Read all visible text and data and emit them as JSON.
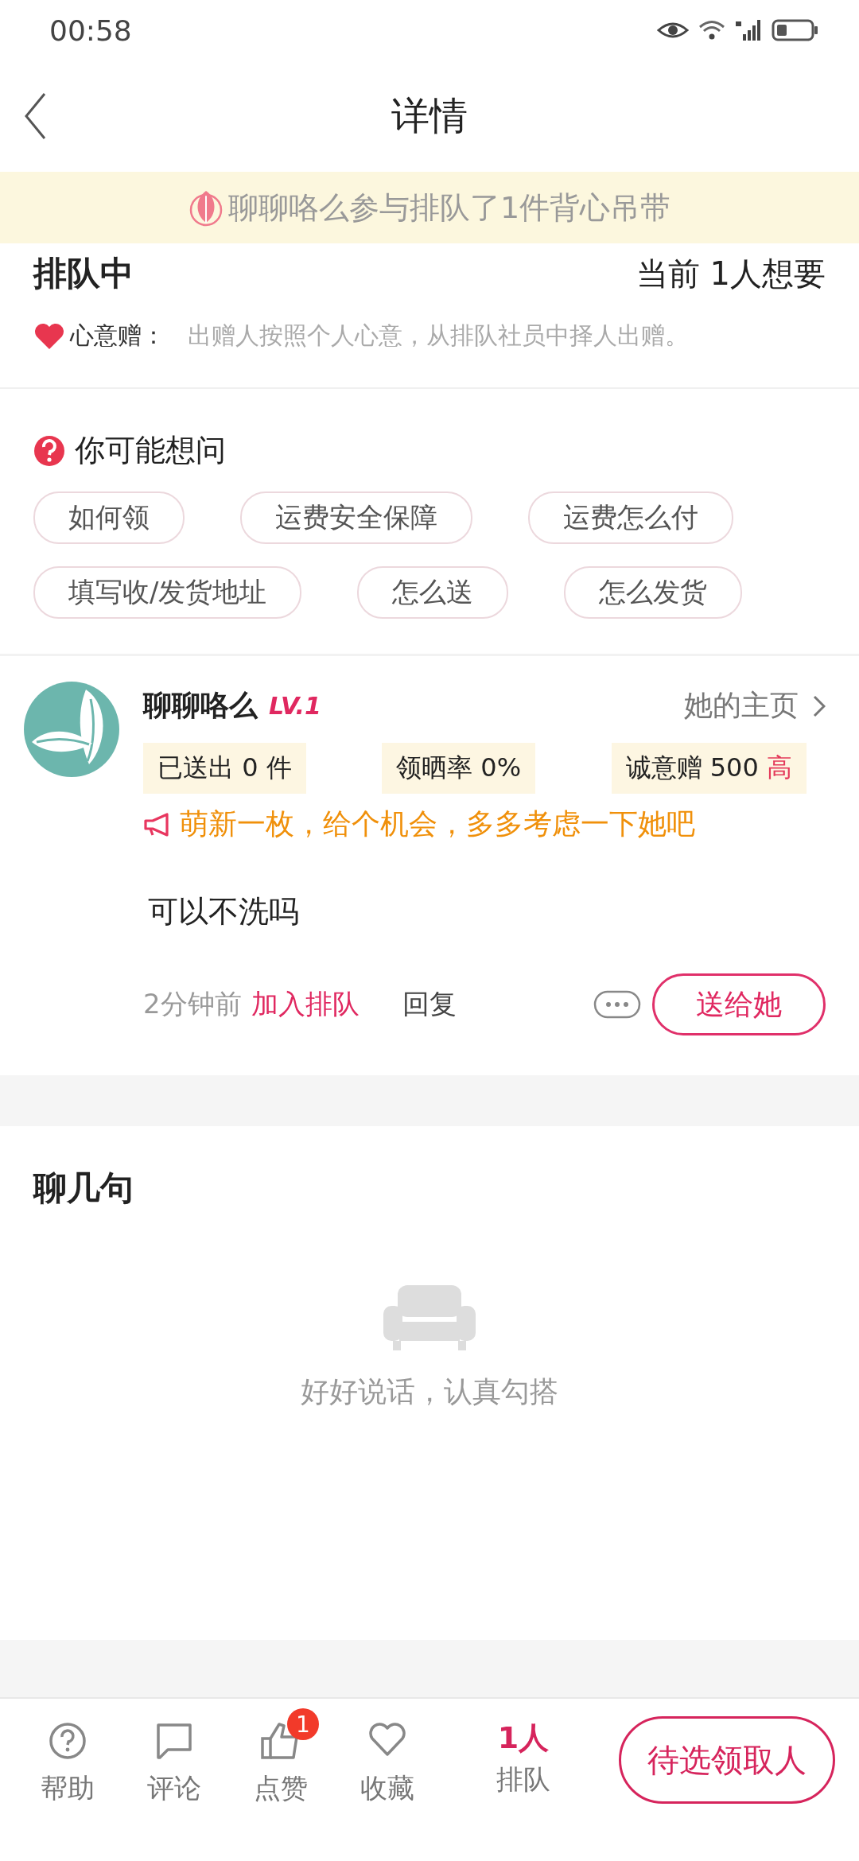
{
  "status_bar": {
    "time": "00:58"
  },
  "header": {
    "title": "详情"
  },
  "banner": {
    "text": "聊聊咯么参与排队了1件背心吊带"
  },
  "queue": {
    "status": "排队中",
    "count": "当前 1人想要",
    "mode_label": "心意赠：",
    "mode_desc": "出赠人按照个人心意，从排队社员中择人出赠。"
  },
  "faq": {
    "title": "你可能想问",
    "chips": [
      "如何领",
      "运费安全保障",
      "运费怎么付",
      "填写收/发货地址",
      "怎么送",
      "怎么发货"
    ]
  },
  "entry": {
    "name": "聊聊咯么",
    "level": "LV.1",
    "profile_link": "她的主页",
    "stats": [
      {
        "text": "已送出 0 件"
      },
      {
        "text": "领晒率 0%"
      },
      {
        "text": "诚意赠 500",
        "tag": "高"
      }
    ],
    "notice": "萌新一枚，给个机会，多多考虑一下她吧",
    "comment": "可以不洗吗",
    "time": "2分钟前",
    "action": "加入排队",
    "reply": "回复",
    "give_button": "送给她"
  },
  "chat": {
    "title": "聊几句",
    "empty_text": "好好说话，认真勾搭"
  },
  "bottom_bar": {
    "tabs": [
      {
        "kind": "help",
        "label": "帮助"
      },
      {
        "kind": "comment",
        "label": "评论"
      },
      {
        "kind": "like",
        "label": "点赞",
        "badge": "1"
      },
      {
        "kind": "favorite",
        "label": "收藏"
      }
    ],
    "queue_count": "1人",
    "queue_label": "排队",
    "primary_button": "待选领取人"
  }
}
